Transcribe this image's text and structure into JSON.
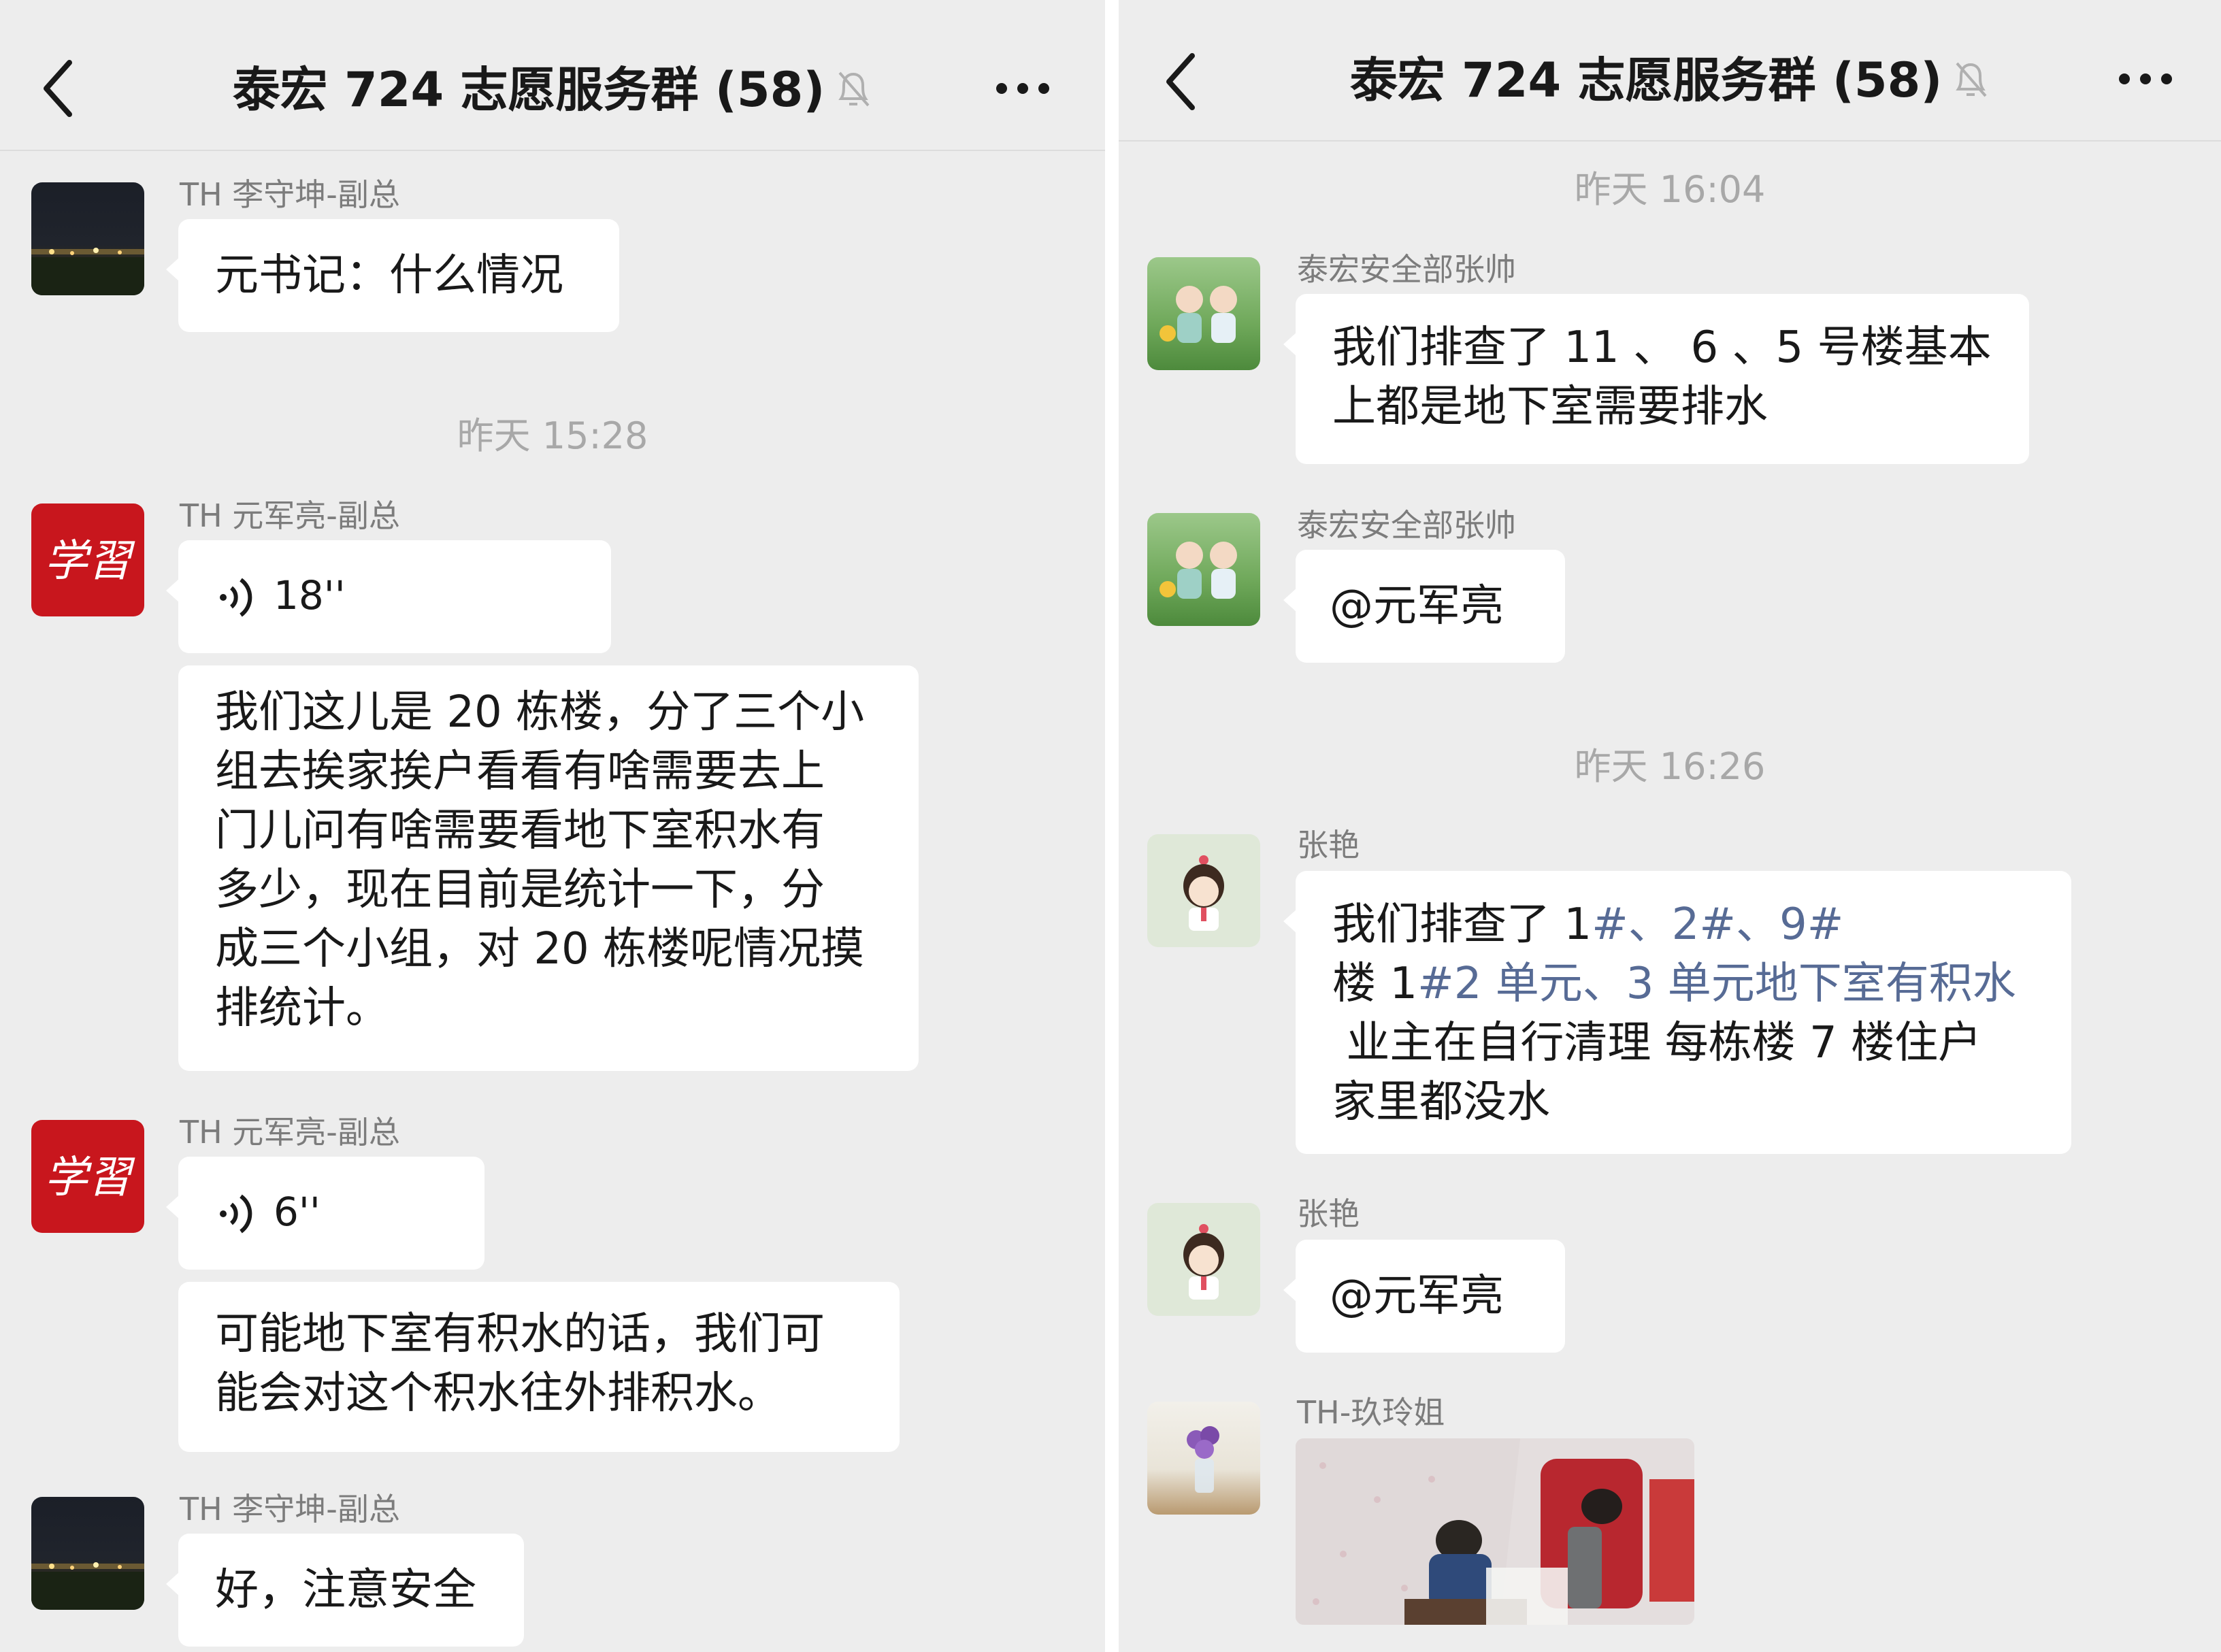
{
  "left": {
    "header": {
      "title": "泰宏 724 志愿服务群 (58)",
      "back_icon": "chevron-left-icon",
      "muted_icon": "bell-slash-icon",
      "more_icon": "ellipsis-icon"
    },
    "messages": [
      {
        "sender": "TH 李守坤-副总",
        "text": "元书记：什么情况"
      },
      {
        "timestamp": "昨天 15:28"
      },
      {
        "sender": "TH 元军亮-副总",
        "voice_duration": "18''",
        "voice_icon": "voice-wave-icon"
      },
      {
        "text": "我们这儿是 20 栋楼，分了三个小组去挨家挨户看看有啥需要去上门儿问有啥需要看地下室积水有多少，现在目前是统计一下，分成三个小组，对 20 栋楼呢情况摸排统计。",
        "lines": [
          "我们这儿是 20 栋楼，分了三个小",
          "组去挨家挨户看看有啥需要去上",
          "门儿问有啥需要看地下室积水有",
          "多少，现在目前是统计一下，分",
          "成三个小组，对 20 栋楼呢情况摸",
          "排统计。"
        ]
      },
      {
        "sender": "TH 元军亮-副总",
        "voice_duration": "6''",
        "voice_icon": "voice-wave-icon"
      },
      {
        "text": "可能地下室有积水的话，我们可能会对这个积水往外排积水。",
        "lines": [
          "可能地下室有积水的话，我们可",
          "能会对这个积水往外排积水。"
        ]
      },
      {
        "sender": "TH 李守坤-副总",
        "text": "好，注意安全"
      }
    ]
  },
  "right": {
    "header": {
      "title": "泰宏 724 志愿服务群 (58)",
      "back_icon": "chevron-left-icon",
      "muted_icon": "bell-slash-icon",
      "more_icon": "ellipsis-icon"
    },
    "messages": [
      {
        "timestamp": "昨天 16:04"
      },
      {
        "sender": "泰宏安全部张帅",
        "text": "我们排查了 11 、 6 、5 号楼基本上都是地下室需要排水",
        "lines": [
          "我们排查了 11 、 6 、5 号楼基本",
          "上都是地下室需要排水"
        ]
      },
      {
        "sender": "泰宏安全部张帅",
        "text": "@元军亮"
      },
      {
        "timestamp": "昨天 16:26"
      },
      {
        "sender": "张艳",
        "line1_a": "我们排查了 1",
        "line1_b": "#、2#、9#",
        "line2_a": "楼 1",
        "line2_b": "#2 单元、3 单元地下室有积水",
        "line3": " 业主在自行清理 每栋楼 7 楼住户",
        "line4": "家里都没水"
      },
      {
        "sender": "张艳",
        "text": "@元军亮"
      },
      {
        "sender": "TH-玖玲姐",
        "image": "flooded-basement-photo"
      }
    ]
  },
  "colors": {
    "background": "#ededed",
    "bubble": "#ffffff",
    "link": "#576b95",
    "timestamp": "#a8a8a8",
    "sender": "#7c7c7c",
    "xuexi_red": "#c8161d"
  }
}
